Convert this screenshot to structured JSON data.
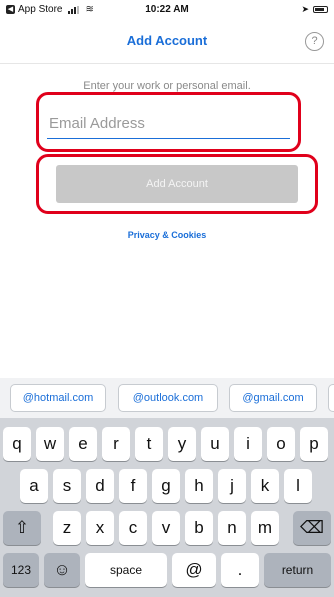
{
  "status_bar": {
    "back_app": "App Store",
    "time": "10:22 AM",
    "wifi_icon": "wifi-icon",
    "location_icon": "location-arrow-icon"
  },
  "nav": {
    "title": "Add Account",
    "help_label": "?"
  },
  "form": {
    "instruction": "Enter your work or personal email.",
    "email_placeholder": "Email Address",
    "email_value": "",
    "add_button_label": "Add Account",
    "privacy_link": "Privacy & Cookies"
  },
  "highlight_color": "#e0001b",
  "accent_color": "#1a6ed8",
  "suggestions": [
    "@hotmail.com",
    "@outlook.com",
    "@gmail.com",
    ""
  ],
  "keyboard": {
    "row1": [
      "q",
      "w",
      "e",
      "r",
      "t",
      "y",
      "u",
      "i",
      "o",
      "p"
    ],
    "row2": [
      "a",
      "s",
      "d",
      "f",
      "g",
      "h",
      "j",
      "k",
      "l"
    ],
    "row3": [
      "z",
      "x",
      "c",
      "v",
      "b",
      "n",
      "m"
    ],
    "shift_label": "⇧",
    "delete_label": "⌫",
    "numbers_label": "123",
    "emoji_label": "☺",
    "space_label": "space",
    "at_label": "@",
    "dot_label": ".",
    "return_label": "return"
  }
}
